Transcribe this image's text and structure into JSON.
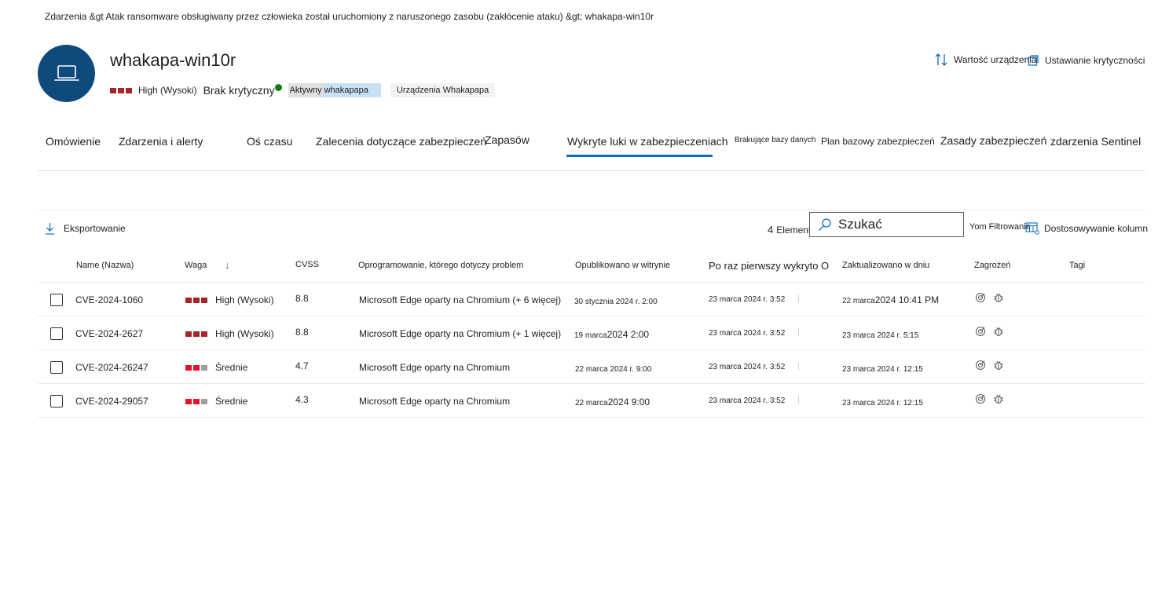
{
  "breadcrumb": "Zdarzenia &gt  Atak ransomware obsługiwany przez człowieka został uruchomiony z naruszonego zasobu (zakłócenie ataku) &gt; whakapa-win10r",
  "device": {
    "name": "whakapa-win10r",
    "risk_label": "High (Wysoki)",
    "criticality_label": "Brak krytyczny",
    "tag_active": "Aktywny whakapapa",
    "tag_devices": "Urządzenia Whakapapa"
  },
  "actions": {
    "device_value": "Wartość urządzenia",
    "set_criticality": "Ustawianie krytyczności"
  },
  "tabs": [
    {
      "label": "Omówienie"
    },
    {
      "label": "Zdarzenia i alerty"
    },
    {
      "label": "Oś czasu"
    },
    {
      "label": "Zalecenia dotyczące zabezpieczeń"
    },
    {
      "label": "Zapasów"
    },
    {
      "label": "Wykryte luki w zabezpieczeniach"
    },
    {
      "label": "Brakujące bazy danych"
    },
    {
      "label": "Plan bazowy zabezpieczeń"
    },
    {
      "label": "Zasady zabezpieczeń"
    },
    {
      "label": "zdarzenia Sentinel"
    }
  ],
  "toolbar": {
    "export": "Eksportowanie",
    "count_number": "4",
    "count_label": "Elementy",
    "search_placeholder": "Szukać",
    "filter_prefix": "Yom",
    "filter": "Filtrowanie",
    "customize_columns": "Dostosowywanie kolumn"
  },
  "columns": {
    "name": "Name (Nazwa)",
    "severity": "Waga",
    "cvss": "CVSS",
    "software": "Oprogramowanie, którego dotyczy problem",
    "published": "Opublikowano w witrynie",
    "first_detected": "Po raz pierwszy wykryto O",
    "updated": "Zaktualizowano w dniu",
    "threats": "Zagrożeń",
    "tags": "Tagi"
  },
  "rows": [
    {
      "cve": "CVE-2024-1060",
      "severity": "High (Wysoki)",
      "level": "high",
      "cvss": "8.8",
      "software": "Microsoft Edge oparty na Chromium (+ 6 więcej)",
      "published_a": "30 stycznia 2024 r. 2:00",
      "published_b": "",
      "first": "23 marca 2024 r. 3:52",
      "updated_a": "22 marca",
      "updated_b": "2024 10:41 PM"
    },
    {
      "cve": "CVE-2024-2627",
      "severity": "High (Wysoki)",
      "level": "high",
      "cvss": "8.8",
      "software": "Microsoft Edge oparty na Chromium (+ 1 więcej)",
      "published_a": "19 marca",
      "published_b": "2024 2:00",
      "first": "23 marca 2024 r. 3:52",
      "updated_a": "23 marca 2024 r. 5:15",
      "updated_b": ""
    },
    {
      "cve": "CVE-2024-26247",
      "severity": "Średnie",
      "level": "medium",
      "cvss": "4.7",
      "software": "Microsoft Edge oparty na Chromium",
      "published_a": "22 marca 2024 r. 9:00",
      "published_b": "",
      "first": "23 marca 2024 r. 3:52",
      "updated_a": "23 marca 2024 r. 12:15",
      "updated_b": ""
    },
    {
      "cve": "CVE-2024-29057",
      "severity": "Średnie",
      "level": "medium",
      "cvss": "4.3",
      "software": "Microsoft Edge oparty na Chromium",
      "published_a": "22 marca",
      "published_b": "2024 9:00",
      "first": "23 marca 2024 r. 3:52",
      "updated_a": "23 marca 2024 r. 12:15",
      "updated_b": ""
    }
  ],
  "colors": {
    "accent": "#0f6cbd",
    "avatar_bg": "#0f4a7c",
    "sev_high": "#a4262c",
    "sev_medium": "#e81123",
    "sev_off": "#a19f9d",
    "status_ok": "#107c10"
  },
  "icons": {
    "avatar": "laptop-icon",
    "sort": "sort-arrows-icon",
    "criticality": "criticality-icon",
    "export": "download-icon",
    "search": "search-icon",
    "columns": "customize-columns-icon",
    "threat_exploit": "target-icon",
    "threat_bug": "bug-icon"
  }
}
